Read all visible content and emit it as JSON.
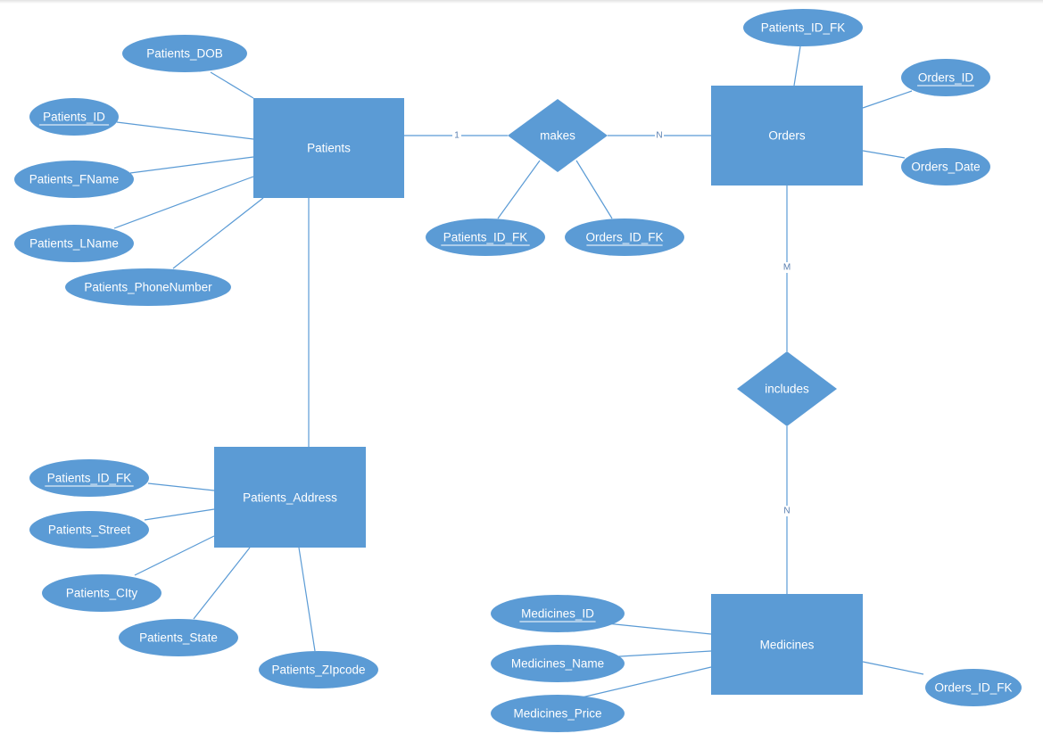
{
  "diagram": {
    "type": "ER diagram",
    "entities": [
      {
        "id": "patients",
        "label": "Patients"
      },
      {
        "id": "orders",
        "label": "Orders"
      },
      {
        "id": "patients_address",
        "label": "Patients_Address"
      },
      {
        "id": "medicines",
        "label": "Medicines"
      }
    ],
    "relationships": [
      {
        "id": "makes",
        "label": "makes"
      },
      {
        "id": "includes",
        "label": "includes"
      }
    ],
    "attributes": [
      {
        "id": "a_pat_dob",
        "owner": "patients",
        "label": "Patients_DOB",
        "key": false
      },
      {
        "id": "a_pat_id",
        "owner": "patients",
        "label": "Patients_ID",
        "key": true
      },
      {
        "id": "a_pat_fname",
        "owner": "patients",
        "label": "Patients_FName",
        "key": false
      },
      {
        "id": "a_pat_lname",
        "owner": "patients",
        "label": "Patients_LName",
        "key": false
      },
      {
        "id": "a_pat_phone",
        "owner": "patients",
        "label": "Patients_PhoneNumber",
        "key": false
      },
      {
        "id": "a_makes_pid",
        "owner": "makes",
        "label": "Patients_ID_FK",
        "key": true
      },
      {
        "id": "a_makes_oid",
        "owner": "makes",
        "label": "Orders_ID_FK",
        "key": true
      },
      {
        "id": "a_ord_pid",
        "owner": "orders",
        "label": "Patients_ID_FK",
        "key": false
      },
      {
        "id": "a_ord_id",
        "owner": "orders",
        "label": "Orders_ID",
        "key": true
      },
      {
        "id": "a_ord_date",
        "owner": "orders",
        "label": "Orders_Date",
        "key": false
      },
      {
        "id": "a_addr_pid",
        "owner": "patients_address",
        "label": "Patients_ID_FK",
        "key": true
      },
      {
        "id": "a_addr_street",
        "owner": "patients_address",
        "label": "Patients_Street",
        "key": false
      },
      {
        "id": "a_addr_city",
        "owner": "patients_address",
        "label": "Patients_CIty",
        "key": false
      },
      {
        "id": "a_addr_state",
        "owner": "patients_address",
        "label": "Patients_State",
        "key": false
      },
      {
        "id": "a_addr_zip",
        "owner": "patients_address",
        "label": "Patients_ZIpcode",
        "key": false
      },
      {
        "id": "a_med_id",
        "owner": "medicines",
        "label": "Medicines_ID",
        "key": true
      },
      {
        "id": "a_med_name",
        "owner": "medicines",
        "label": "Medicines_Name",
        "key": false
      },
      {
        "id": "a_med_price",
        "owner": "medicines",
        "label": "Medicines_Price",
        "key": false
      },
      {
        "id": "a_med_oid",
        "owner": "medicines",
        "label": "Orders_ID_FK",
        "key": false
      }
    ],
    "links": [
      {
        "from": "patients",
        "to": "makes",
        "cardinality": "1"
      },
      {
        "from": "makes",
        "to": "orders",
        "cardinality": "N"
      },
      {
        "from": "orders",
        "to": "includes",
        "cardinality": "M"
      },
      {
        "from": "includes",
        "to": "medicines",
        "cardinality": "N"
      },
      {
        "from": "patients",
        "to": "patients_address",
        "cardinality": ""
      }
    ],
    "colors": {
      "shape_fill": "#5b9bd5",
      "line": "#5b9bd5",
      "label_text": "#ffffff",
      "cardinality_text": "#5a7fb0",
      "background": "#ffffff"
    }
  }
}
